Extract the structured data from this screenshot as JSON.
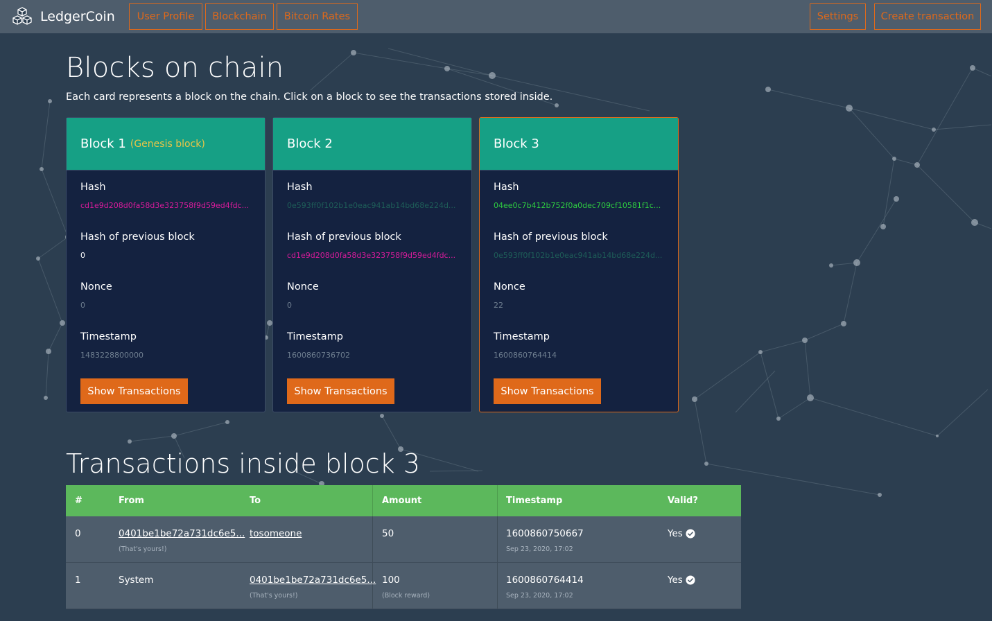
{
  "app": {
    "name": "LedgerCoin"
  },
  "nav": {
    "user_profile": "User Profile",
    "blockchain": "Blockchain",
    "bitcoin_rates": "Bitcoin Rates",
    "settings": "Settings",
    "create_transaction": "Create transaction"
  },
  "page": {
    "title": "Blocks on chain",
    "subtitle": "Each card represents a block on the chain. Click on a block to see the transactions stored inside."
  },
  "colors": {
    "accent": "#df691a",
    "card_header": "#16a085",
    "table_header": "#5cb85c",
    "hash_magenta": "#d81b9b",
    "hash_green": "#2ecc40",
    "hash_dim_green": "#1e5e58",
    "muted": "#6f7f90"
  },
  "labels": {
    "hash": "Hash",
    "prev_hash": "Hash of previous block",
    "nonce": "Nonce",
    "timestamp": "Timestamp",
    "show_tx": "Show Transactions"
  },
  "blocks": [
    {
      "title": "Block 1",
      "tag": "(Genesis block)",
      "hash": "cd1e9d208d0fa58d3e323758f9d59ed4fdc...",
      "prev_hash": "0",
      "nonce": "0",
      "timestamp": "1483228800000"
    },
    {
      "title": "Block 2",
      "tag": "",
      "hash": "0e593ff0f102b1e0eac941ab14bd68e224d...",
      "prev_hash": "cd1e9d208d0fa58d3e323758f9d59ed4fdc...",
      "nonce": "0",
      "timestamp": "1600860736702"
    },
    {
      "title": "Block 3",
      "tag": "",
      "hash": "04ee0c7b412b752f0a0dec709cf10581f1c...",
      "prev_hash": "0e593ff0f102b1e0eac941ab14bd68e224d...",
      "nonce": "22",
      "timestamp": "1600860764414"
    }
  ],
  "transactions": {
    "title": "Transactions inside block 3",
    "headers": [
      "#",
      "From",
      "To",
      "Amount",
      "Timestamp",
      "Valid?"
    ],
    "rows": [
      {
        "index": "0",
        "from": "0401be1be72a731dc6e5...",
        "from_note": "(That's yours!)",
        "to": "tosomeone",
        "to_note": "",
        "amount": "50",
        "amount_note": "",
        "timestamp": "1600860750667",
        "date": "Sep 23, 2020, 17:02",
        "valid": "Yes"
      },
      {
        "index": "1",
        "from": "System",
        "from_note": "",
        "to": "0401be1be72a731dc6e5...",
        "to_note": "(That's yours!)",
        "amount": "100",
        "amount_note": "(Block reward)",
        "timestamp": "1600860764414",
        "date": "Sep 23, 2020, 17:02",
        "valid": "Yes"
      }
    ]
  }
}
